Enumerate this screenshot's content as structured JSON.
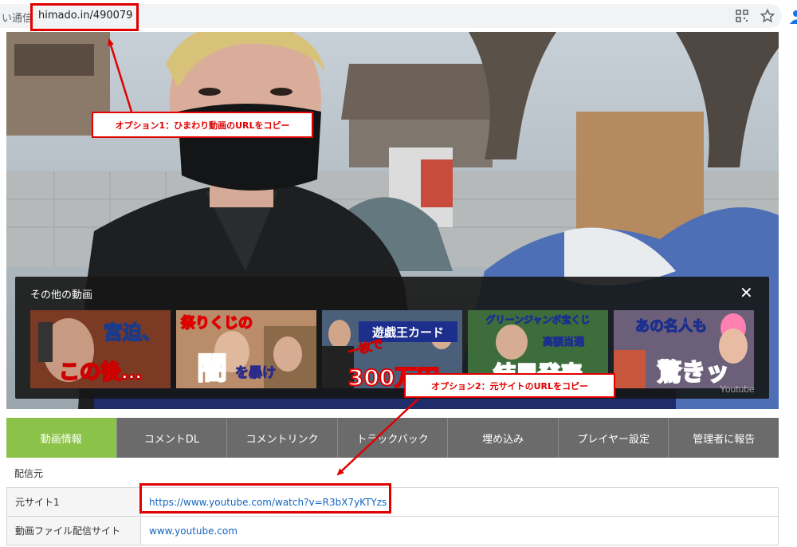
{
  "browser": {
    "security_text": "い通信",
    "url": "himado.in/490079"
  },
  "related": {
    "title": "その他の動画",
    "close": "✕",
    "thumbnails": [
      {
        "caption_top": "宮迫、",
        "caption_bottom": "この後…"
      },
      {
        "caption_top": "祭りくじの",
        "caption_big": "闇",
        "caption_small": "を暴け"
      },
      {
        "caption_top": "遊戯王カード",
        "caption_mid": "一枚で",
        "caption_bottom": "300万円"
      },
      {
        "caption_top": "グリーンジャンボ宝くじ",
        "caption_mid": "高額当選",
        "caption_bottom": "結果発表"
      },
      {
        "caption_top": "あの名人も",
        "caption_bottom": "驚きッ"
      }
    ]
  },
  "video": {
    "watermark": "Youtube"
  },
  "tabs": [
    {
      "label": "動画情報",
      "active": true
    },
    {
      "label": "コメントDL",
      "active": false
    },
    {
      "label": "コメントリンク",
      "active": false
    },
    {
      "label": "トラックバック",
      "active": false
    },
    {
      "label": "埋め込み",
      "active": false
    },
    {
      "label": "プレイヤー設定",
      "active": false
    },
    {
      "label": "管理者に報告",
      "active": false
    }
  ],
  "source": {
    "section_label": "配信元",
    "rows": [
      {
        "key": "元サイト1",
        "value": "https://www.youtube.com/watch?v=R3bX7yKTYzs"
      },
      {
        "key": "動画ファイル配信サイト",
        "value": "www.youtube.com"
      }
    ]
  },
  "annotations": {
    "option1": "オプション1：ひまわり動画のURLをコピー",
    "option2": "オプション2：元サイトのURLをコピー"
  },
  "colors": {
    "annotation_red": "#e00000",
    "active_tab": "#8bc34a",
    "tab_gray": "#6b6b6b",
    "link_blue": "#1565c0"
  }
}
